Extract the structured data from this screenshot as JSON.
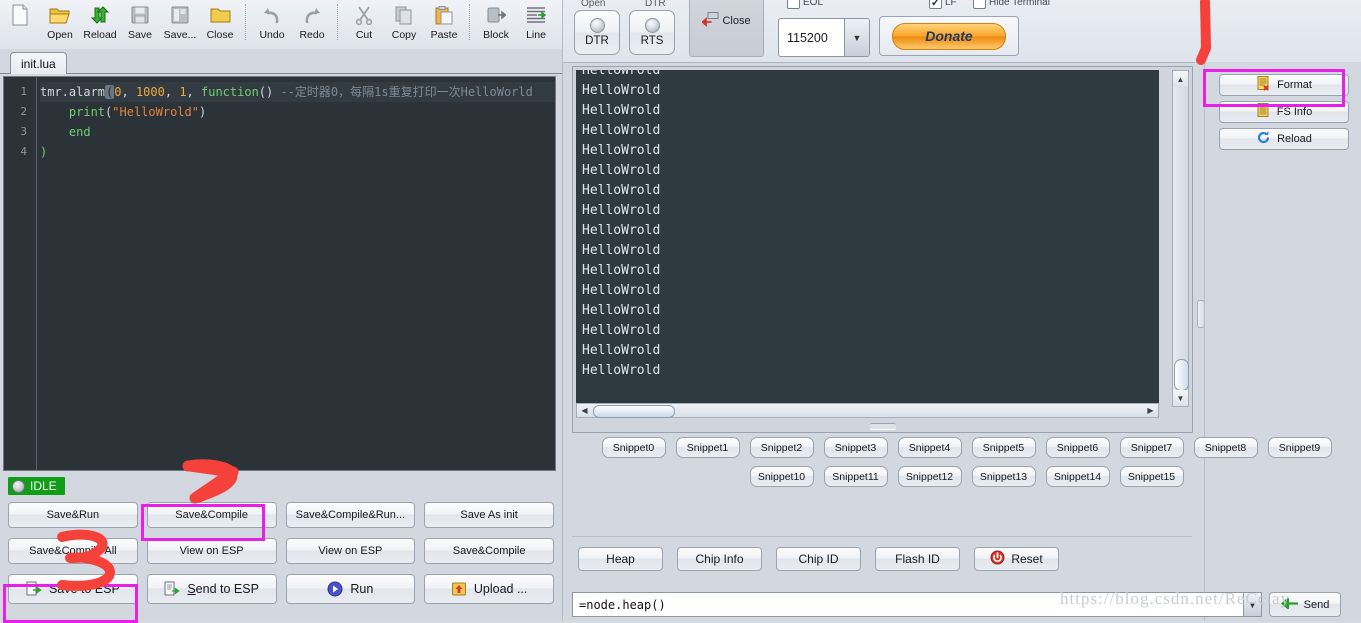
{
  "editor": {
    "toolbar": [
      {
        "label": "",
        "icon": "new-file-icon"
      },
      {
        "label": "Open",
        "icon": "open-folder-icon"
      },
      {
        "label": "Reload",
        "icon": "reload-icon"
      },
      {
        "label": "Save",
        "icon": "save-disk-icon"
      },
      {
        "label": "Save...",
        "icon": "save-as-icon"
      },
      {
        "label": "Close",
        "icon": "close-folder-icon"
      },
      {
        "label": "Undo",
        "icon": "undo-icon"
      },
      {
        "label": "Redo",
        "icon": "redo-icon"
      },
      {
        "label": "Cut",
        "icon": "scissors-icon"
      },
      {
        "label": "Copy",
        "icon": "copy-icon"
      },
      {
        "label": "Paste",
        "icon": "paste-icon"
      },
      {
        "label": "Block",
        "icon": "block-icon"
      },
      {
        "label": "Line",
        "icon": "line-icon"
      }
    ],
    "tab": "init.lua",
    "line_numbers": [
      "1",
      "2",
      "3",
      "4"
    ],
    "code": {
      "l1_a": "tmr.alarm",
      "l1_cursor": "(",
      "l1_b": "0",
      "l1_c": ", ",
      "l1_d": "1000",
      "l1_e": ", ",
      "l1_f": "1",
      "l1_g": ", ",
      "l1_kw": "function",
      "l1_h": "() ",
      "l1_comment": "--定时器0，每隔1s重复打印一次HelloWorld",
      "l2_indent": "    ",
      "l2_fn": "print",
      "l2_open": "(",
      "l2_str": "\"HelloWrold\"",
      "l2_close": ")",
      "l3": "    end",
      "l4": ")"
    },
    "status": "IDLE",
    "buttons_row1": [
      "Save&Run",
      "Save&Compile",
      "Save&Compile&Run...",
      "Save As init"
    ],
    "buttons_row2": [
      "Save&Compile All",
      "View on ESP",
      "View on ESP",
      "Save&Compile"
    ],
    "buttons_row3": [
      {
        "label": "Save to ESP",
        "icon": "save-to-esp-icon",
        "accel": ""
      },
      {
        "label": "Send to ESP",
        "icon": "send-to-esp-icon",
        "accel": "S"
      },
      {
        "label": "Run",
        "icon": "run-play-icon",
        "accel": ""
      },
      {
        "label": "Upload ...",
        "icon": "upload-icon",
        "accel": ""
      }
    ]
  },
  "serial": {
    "cut_labels": [
      "Open",
      "DTR"
    ],
    "dtr": "DTR",
    "rts": "RTS",
    "close": "Close",
    "baud": "115200",
    "donate": "Donate",
    "checkboxes": [
      {
        "label": "EOL",
        "checked": false
      },
      {
        "label": "LF",
        "checked": true
      },
      {
        "label": "Hide Terminal",
        "checked": false
      }
    ]
  },
  "terminal": {
    "lines": [
      "HelloWrold",
      "HelloWrold",
      "HelloWrold",
      "HelloWrold",
      "HelloWrold",
      "HelloWrold",
      "HelloWrold",
      "HelloWrold",
      "HelloWrold",
      "HelloWrold",
      "HelloWrold",
      "HelloWrold",
      "HelloWrold",
      "HelloWrold",
      "HelloWrold",
      "HelloWrold"
    ]
  },
  "fs_panel": {
    "buttons": [
      {
        "label": "Format",
        "icon": "format-file-icon"
      },
      {
        "label": "FS Info",
        "icon": "fs-info-icon"
      },
      {
        "label": "Reload",
        "icon": "refresh-icon"
      }
    ]
  },
  "snippets": {
    "row1": [
      "Snippet0",
      "Snippet1",
      "Snippet2",
      "Snippet3",
      "Snippet4",
      "Snippet5",
      "Snippet6",
      "Snippet7",
      "Snippet8",
      "Snippet9"
    ],
    "row2": [
      "Snippet10",
      "Snippet11",
      "Snippet12",
      "Snippet13",
      "Snippet14",
      "Snippet15"
    ]
  },
  "info_buttons": [
    {
      "label": "Heap",
      "icon": ""
    },
    {
      "label": "Chip Info",
      "icon": ""
    },
    {
      "label": "Chip ID",
      "icon": ""
    },
    {
      "label": "Flash ID",
      "icon": ""
    },
    {
      "label": "Reset",
      "icon": "power-reset-icon"
    }
  ],
  "command": {
    "value": "=node.heap()",
    "send_label": "Send",
    "send_icon": "send-arrow-icon"
  },
  "watermark": "https://blog.csdn.net/ReCclay",
  "annotations": {
    "highlight_color": "#e81fe8",
    "marker_color": "#f4413a",
    "marks": [
      "1",
      "2",
      "3"
    ]
  }
}
